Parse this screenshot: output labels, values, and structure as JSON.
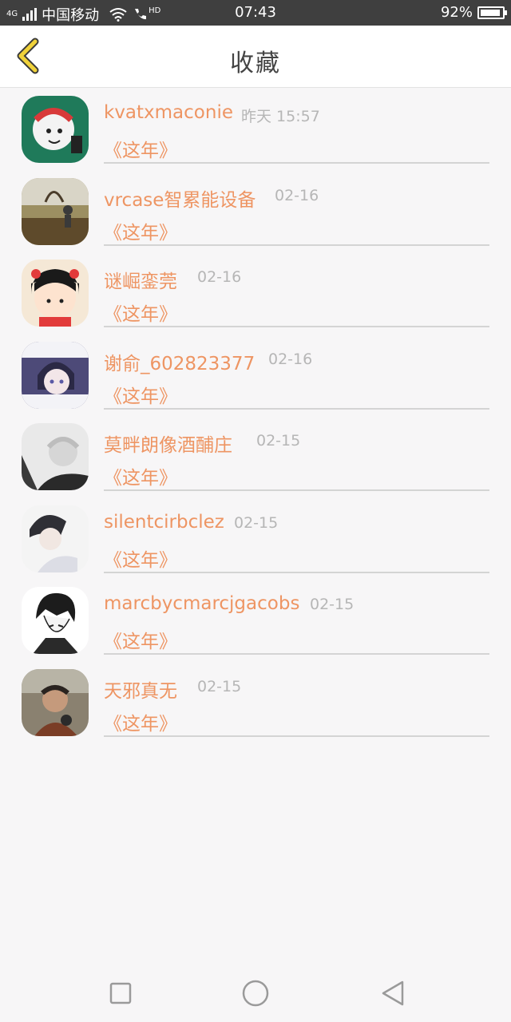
{
  "status_bar": {
    "network": "4G",
    "carrier": "中国移动",
    "hd": "HD",
    "time": "07:43",
    "battery": "92%",
    "battery_level": 0.92
  },
  "header": {
    "title": "收藏",
    "back_icon": "chevron-left-icon",
    "accent_color": "#f0d23a"
  },
  "colors": {
    "name": "#ee9563",
    "time": "#b6b6b6",
    "divider": "#d4d4d4"
  },
  "favorites": [
    {
      "user": "kvatxmaconie",
      "time": "昨天 15:57",
      "work": "《这年》"
    },
    {
      "user": "vrcase智累能设备",
      "time": "02-16",
      "work": "《这年》"
    },
    {
      "user": "谜崛銮莞",
      "time": "02-16",
      "work": "《这年》"
    },
    {
      "user": "谢俞_602823377",
      "time": "02-16",
      "work": "《这年》"
    },
    {
      "user": "莫畔朗像酒酺庄",
      "time": "02-15",
      "work": "《这年》"
    },
    {
      "user": "silentcirbclez",
      "time": "02-15",
      "work": "《这年》"
    },
    {
      "user": "marcbycmarcjgacobs",
      "time": "02-15",
      "work": "《这年》"
    },
    {
      "user": "天邪真无",
      "time": "02-15",
      "work": "《这年》"
    }
  ],
  "nav_bar": {
    "recents": "square-icon",
    "home": "circle-icon",
    "back": "triangle-back-icon"
  }
}
